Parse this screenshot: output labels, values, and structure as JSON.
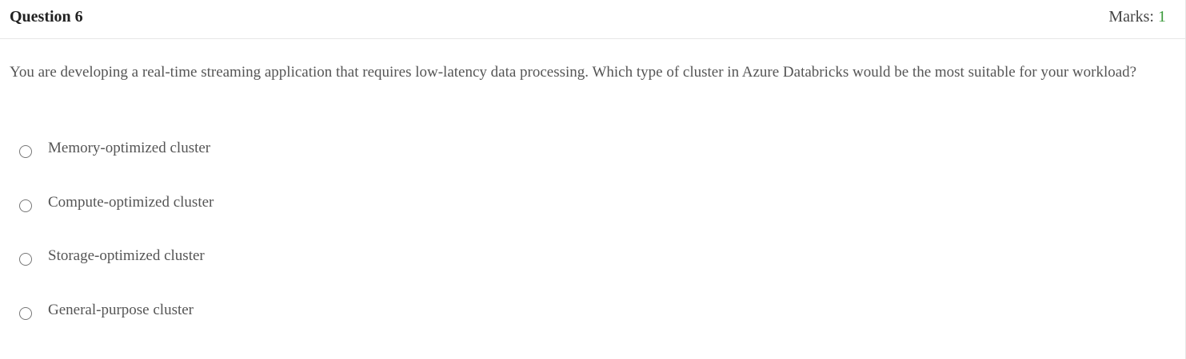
{
  "question": {
    "title": "Question 6",
    "marks_label": "Marks: ",
    "marks_value": "1",
    "text": "You are developing a real-time streaming application that requires low-latency data processing. Which type of cluster in Azure Databricks would be the most suitable for your workload?"
  },
  "options": [
    {
      "label": "Memory-optimized cluster",
      "selected": false
    },
    {
      "label": "Compute-optimized cluster",
      "selected": false
    },
    {
      "label": "Storage-optimized cluster",
      "selected": false
    },
    {
      "label": "General-purpose cluster",
      "selected": false
    }
  ]
}
